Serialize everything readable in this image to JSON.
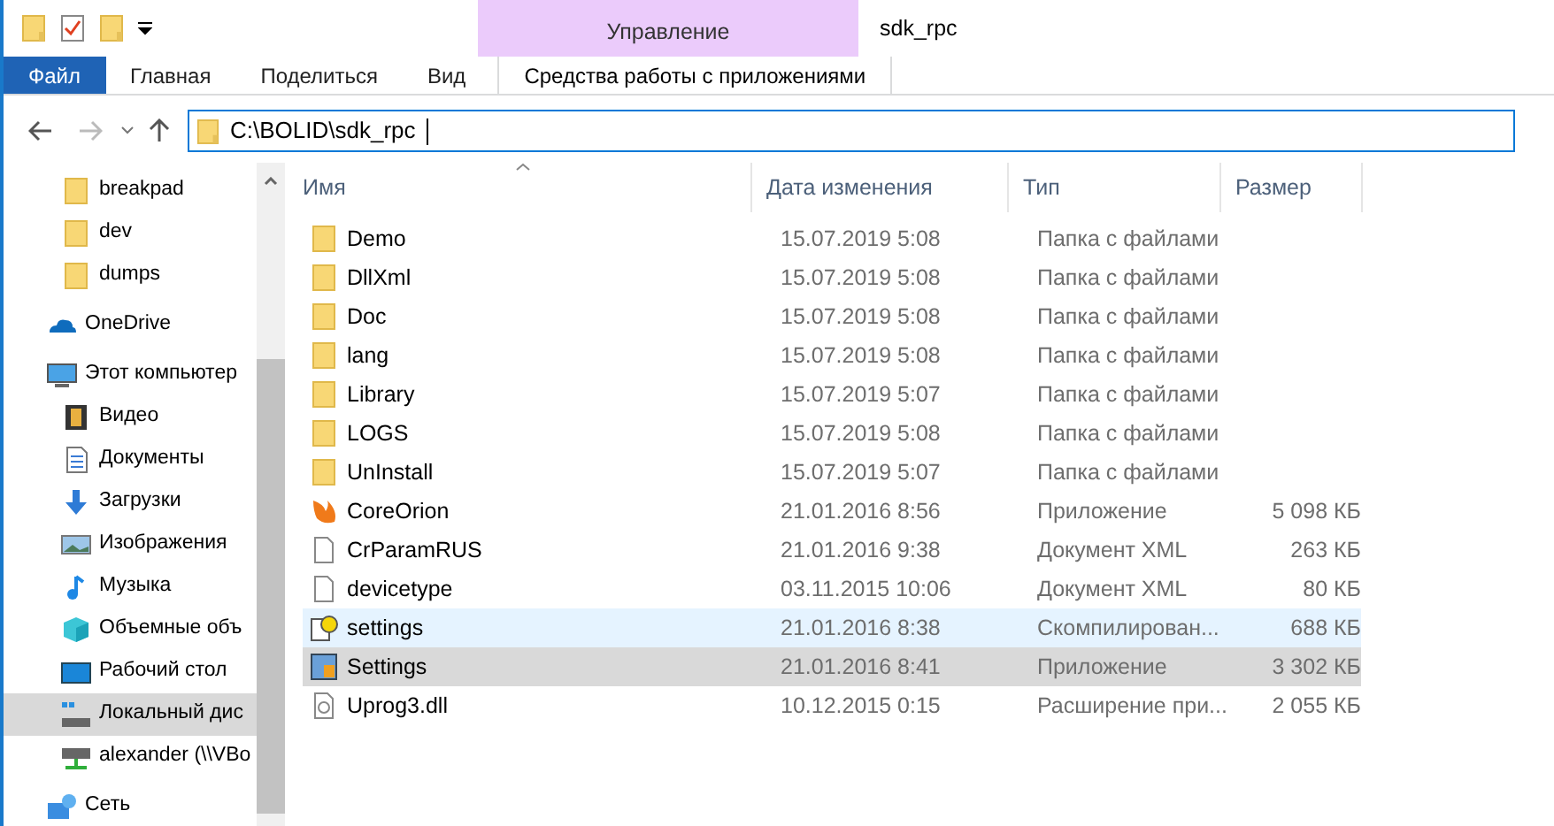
{
  "window": {
    "title": "sdk_rpc"
  },
  "ribbon": {
    "context_group": "Управление",
    "tabs": [
      {
        "label": "Файл",
        "kind": "file",
        "selected": false
      },
      {
        "label": "Главная",
        "kind": "tab",
        "selected": false
      },
      {
        "label": "Поделиться",
        "kind": "tab",
        "selected": false
      },
      {
        "label": "Вид",
        "kind": "tab",
        "selected": false
      },
      {
        "label": "Средства работы с приложениями",
        "kind": "context",
        "selected": false
      }
    ]
  },
  "address": {
    "value": "C:\\BOLID\\sdk_rpc"
  },
  "sidebar": {
    "items": [
      {
        "label": "breakpad",
        "kind": "folder",
        "selected": false
      },
      {
        "label": "dev",
        "kind": "folder",
        "selected": false
      },
      {
        "label": "dumps",
        "kind": "folder",
        "selected": false
      },
      {
        "label": "OneDrive",
        "kind": "cloud",
        "selected": false
      },
      {
        "label": "Этот компьютер",
        "kind": "computer",
        "selected": false,
        "children": [
          {
            "label": "Видео",
            "kind": "video",
            "selected": false
          },
          {
            "label": "Документы",
            "kind": "documents",
            "selected": false
          },
          {
            "label": "Загрузки",
            "kind": "downloads",
            "selected": false
          },
          {
            "label": "Изображения",
            "kind": "images",
            "selected": false
          },
          {
            "label": "Музыка",
            "kind": "music",
            "selected": false
          },
          {
            "label": "Объемные объ",
            "kind": "cube",
            "selected": false
          },
          {
            "label": "Рабочий стол",
            "kind": "desktop",
            "selected": false
          },
          {
            "label": "Локальный дис",
            "kind": "disk",
            "selected": true
          },
          {
            "label": "alexander (\\\\VBo",
            "kind": "netdrive",
            "selected": false
          }
        ]
      },
      {
        "label": "Сеть",
        "kind": "network",
        "selected": false
      }
    ]
  },
  "table": {
    "columns": [
      "Имя",
      "Дата изменения",
      "Тип",
      "Размер"
    ],
    "rows": [
      {
        "name": "Demo",
        "date": "15.07.2019 5:08",
        "type": "Папка с файлами",
        "kind": "folder",
        "selected": false,
        "hovered": false
      },
      {
        "name": "DllXml",
        "date": "15.07.2019 5:08",
        "type": "Папка с файлами",
        "kind": "folder",
        "selected": false,
        "hovered": false
      },
      {
        "name": "Doc",
        "date": "15.07.2019 5:08",
        "type": "Папка с файлами",
        "kind": "folder",
        "selected": false,
        "hovered": false
      },
      {
        "name": "lang",
        "date": "15.07.2019 5:08",
        "type": "Папка с файлами",
        "kind": "folder",
        "selected": false,
        "hovered": false
      },
      {
        "name": "Library",
        "date": "15.07.2019 5:07",
        "type": "Папка с файлами",
        "kind": "folder",
        "selected": false,
        "hovered": false
      },
      {
        "name": "LOGS",
        "date": "15.07.2019 5:08",
        "type": "Папка с файлами",
        "kind": "folder",
        "selected": false,
        "hovered": false
      },
      {
        "name": "UnInstall",
        "date": "15.07.2019 5:07",
        "type": "Папка с файлами",
        "kind": "folder",
        "selected": false,
        "hovered": false
      },
      {
        "name": "CoreOrion",
        "date": "21.01.2016 8:56",
        "type": "Приложение",
        "size": "5 098 КБ",
        "kind": "flame",
        "selected": false,
        "hovered": false
      },
      {
        "name": "CrParamRUS",
        "date": "21.01.2016 9:38",
        "type": "Документ XML",
        "size": "263 КБ",
        "kind": "document",
        "selected": false,
        "hovered": false
      },
      {
        "name": "devicetype",
        "date": "03.11.2015 10:06",
        "type": "Документ XML",
        "size": "80 КБ",
        "kind": "document",
        "selected": false,
        "hovered": false
      },
      {
        "name": "settings",
        "date": "21.01.2016 8:38",
        "type": "Скомпилирован...",
        "size": "688 КБ",
        "kind": "help",
        "selected": false,
        "hovered": true
      },
      {
        "name": "Settings",
        "date": "21.01.2016 8:41",
        "type": "Приложение",
        "size": "3 302 КБ",
        "kind": "tool",
        "selected": true,
        "hovered": false
      },
      {
        "name": "Uprog3.dll",
        "date": "10.12.2015 0:15",
        "type": "Расширение при...",
        "size": "2 055 КБ",
        "kind": "dll",
        "selected": false,
        "hovered": false
      }
    ]
  }
}
